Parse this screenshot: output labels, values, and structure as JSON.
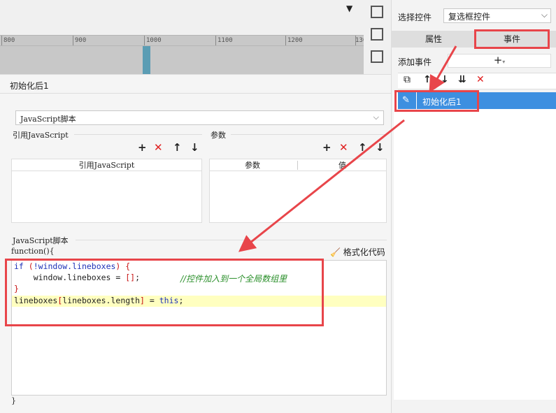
{
  "ruler": {
    "ticks": [
      "800",
      "900",
      "1000",
      "1100",
      "1200",
      "130"
    ]
  },
  "right_panel": {
    "select_label": "选择控件",
    "select_value": "复选框控件",
    "tabs": {
      "attributes": "属性",
      "events": "事件"
    },
    "add_event_label": "添加事件",
    "add_event_plus": "+",
    "event_items": [
      {
        "label": "初始化后1"
      }
    ]
  },
  "dialog": {
    "title": "初始化后1",
    "type_select": "JavaScript脚本",
    "ref_section_label": "引用JavaScript",
    "ref_grid_header": "引用JavaScript",
    "params_section_label": "参数",
    "params_grid_headers": [
      "参数",
      "值"
    ],
    "script_section_label": "JavaScript脚本",
    "function_open": "function(){",
    "function_close": "}",
    "format_button": "格式化代码",
    "code": {
      "l1_kw": "if",
      "l1_a": " (",
      "l1_b": "!window.lineboxes",
      "l1_c": ") {",
      "l2_a": "    window.lineboxes = ",
      "l2_b": "[]",
      "l2_c": ";",
      "l2_comment": "//控件加入到一个全局数组里",
      "l3": "}",
      "l4_a": "lineboxes",
      "l4_b": "[",
      "l4_c": "lineboxes.length",
      "l4_d": "]",
      "l4_e": " = ",
      "l4_kw": "this",
      "l4_f": ";"
    }
  },
  "colors": {
    "accent_red": "#e8454a",
    "selection_blue": "#3d8fe0",
    "highlight_line": "#ffffc0"
  }
}
